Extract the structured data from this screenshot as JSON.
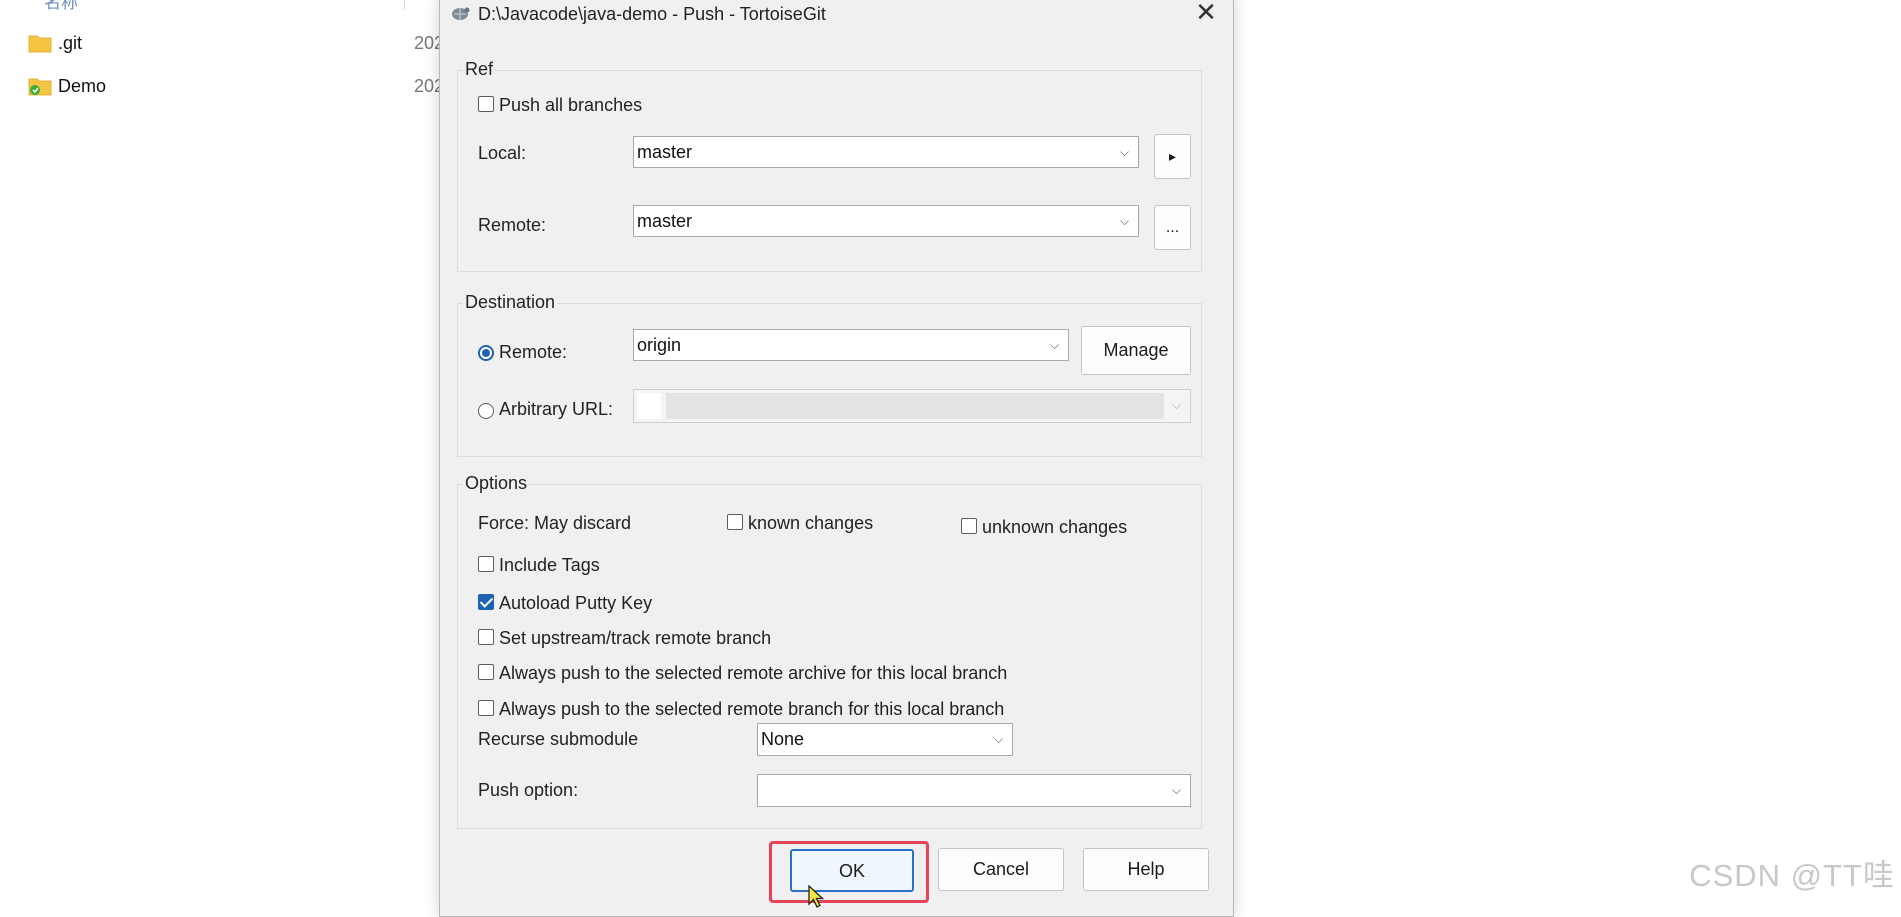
{
  "explorer": {
    "header_fragment": "名称",
    "files": [
      {
        "name": ".git",
        "date": "202"
      },
      {
        "name": "Demo",
        "date": "202"
      }
    ],
    "watermark": "CSDN @TT哇"
  },
  "dialog": {
    "title": "D:\\Javacode\\java-demo - Push - TortoiseGit",
    "close_glyph": "✕",
    "ref": {
      "label": "Ref",
      "push_all_branches": {
        "label": "Push all branches",
        "checked": false
      },
      "local_label": "Local:",
      "local_value": "master",
      "remote_label": "Remote:",
      "remote_value": "master",
      "local_button": "▸",
      "remote_button": "..."
    },
    "destination": {
      "label": "Destination",
      "remote_radio_label": "Remote:",
      "remote_selected": true,
      "remote_value": "origin",
      "manage_label": "Manage",
      "arbitrary_url_label": "Arbitrary URL:",
      "arbitrary_url_value": ""
    },
    "options": {
      "label": "Options",
      "force_label": "Force: May discard",
      "known_changes": {
        "label": "known changes",
        "checked": false
      },
      "unknown_changes": {
        "label": "unknown changes",
        "checked": false
      },
      "include_tags": {
        "label": "Include Tags",
        "checked": false
      },
      "autoload_putty": {
        "label": "Autoload Putty Key",
        "checked": true
      },
      "set_upstream": {
        "label": "Set upstream/track remote branch",
        "checked": false
      },
      "always_push_archive": {
        "label": "Always push to the selected remote archive for this local branch",
        "checked": false
      },
      "always_push_branch": {
        "label": "Always push to the selected remote branch for this local branch",
        "checked": false
      },
      "recurse_label": "Recurse submodule",
      "recurse_value": "None",
      "push_option_label": "Push option:",
      "push_option_value": ""
    },
    "buttons": {
      "ok": "OK",
      "cancel": "Cancel",
      "help": "Help"
    }
  },
  "colors": {
    "accent": "#1e62b4",
    "highlight": "#e5435a",
    "dialog_bg": "#f0f0f0"
  }
}
